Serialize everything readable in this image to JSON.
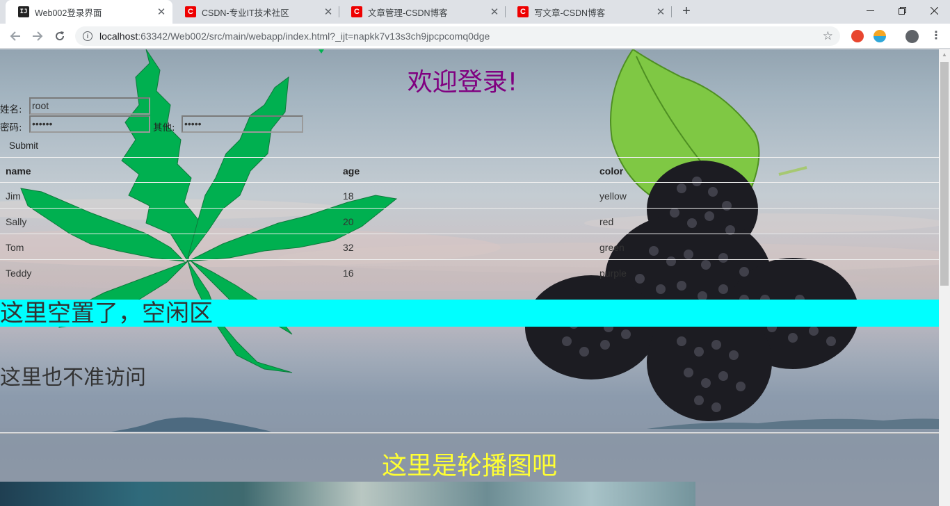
{
  "tabs": [
    {
      "title": "Web002登录界面",
      "favicon": "intellij-icon",
      "active": true
    },
    {
      "title": "CSDN-专业IT技术社区",
      "favicon": "csdn-icon",
      "active": false
    },
    {
      "title": "文章管理-CSDN博客",
      "favicon": "csdn-icon",
      "active": false
    },
    {
      "title": "写文章-CSDN博客",
      "favicon": "csdn-icon",
      "active": false
    }
  ],
  "address": {
    "host": "localhost",
    "rest": ":63342/Web002/src/main/webapp/index.html?_ijt=napkk7v13s3ch9jpcpcomq0dge"
  },
  "page": {
    "heading": "欢迎登录!",
    "form": {
      "name_label": "姓名:",
      "name_value": "root",
      "password_label": "密码:",
      "password_value": "••••••",
      "other_label": "其他:",
      "other_value": "•••••",
      "submit_label": "Submit"
    },
    "table": {
      "headers": [
        "name",
        "age",
        "color"
      ],
      "rows": [
        [
          "Jim",
          "18",
          "yellow"
        ],
        [
          "Sally",
          "20",
          "red"
        ],
        [
          "Tom",
          "32",
          "green"
        ],
        [
          "Teddy",
          "16",
          "purple"
        ]
      ]
    },
    "idle_text": "这里空置了，空闲区",
    "no_access_text": "这里也不准访问",
    "carousel_title": "这里是轮播图吧"
  },
  "colors": {
    "heading": "#800080",
    "idle_band": "#00ffff",
    "carousel_title": "#ffff33",
    "leaf": "#00b050"
  }
}
